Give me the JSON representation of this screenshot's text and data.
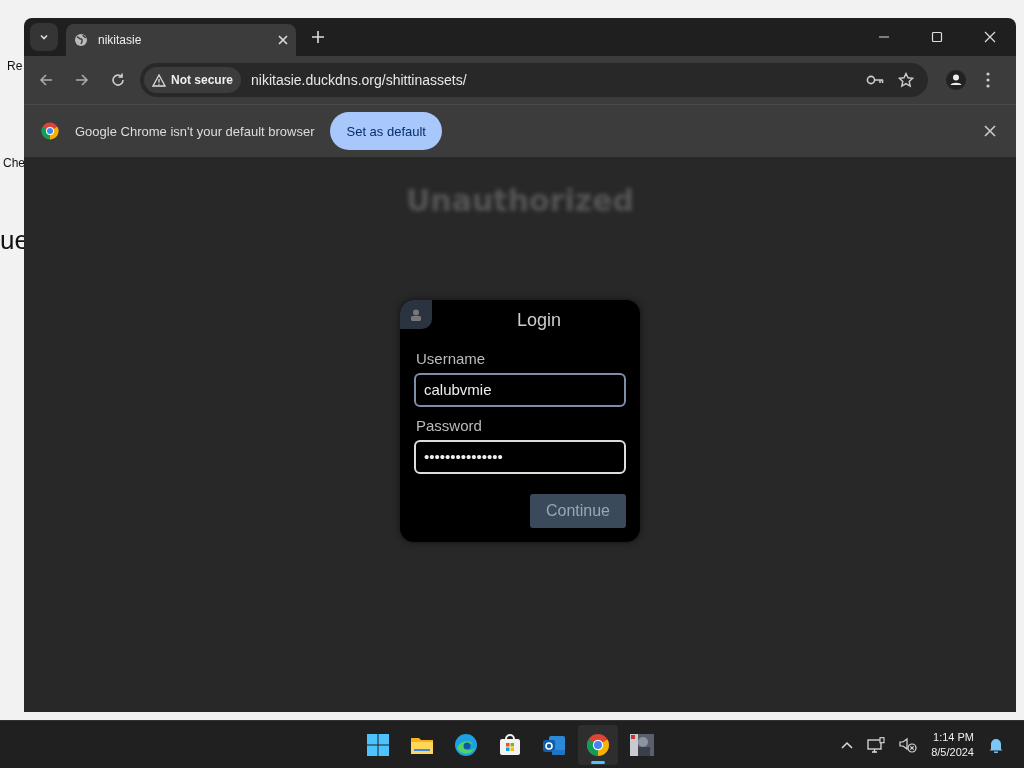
{
  "desktop": {
    "icon_labels": [
      "Re",
      "Che",
      "ue"
    ]
  },
  "browser": {
    "tabs": [
      {
        "title": "nikitasie",
        "selected": true
      }
    ],
    "address_bar": {
      "security": "Not secure",
      "url": "nikitasie.duckdns.org/shittinassets/"
    },
    "infobar": {
      "message": "Google Chrome isn't your default browser",
      "button": "Set as default"
    }
  },
  "page": {
    "heading": "Unauthorized",
    "login": {
      "title": "Login",
      "fields": [
        {
          "label": "Username",
          "value": "calubvmie",
          "focused": true
        },
        {
          "label": "Password",
          "value": "•••••••••••••••",
          "focused": false
        }
      ],
      "button": "Continue"
    }
  },
  "taskbar": {
    "apps": [
      {
        "kind": "start",
        "running": false
      },
      {
        "kind": "files",
        "running": false
      },
      {
        "kind": "edge",
        "running": false
      },
      {
        "kind": "store",
        "running": false
      },
      {
        "kind": "mail",
        "running": false
      },
      {
        "kind": "chrome",
        "running": true
      },
      {
        "kind": "game",
        "running": false
      }
    ],
    "time": "1:14 PM",
    "date": "8/5/2024"
  }
}
